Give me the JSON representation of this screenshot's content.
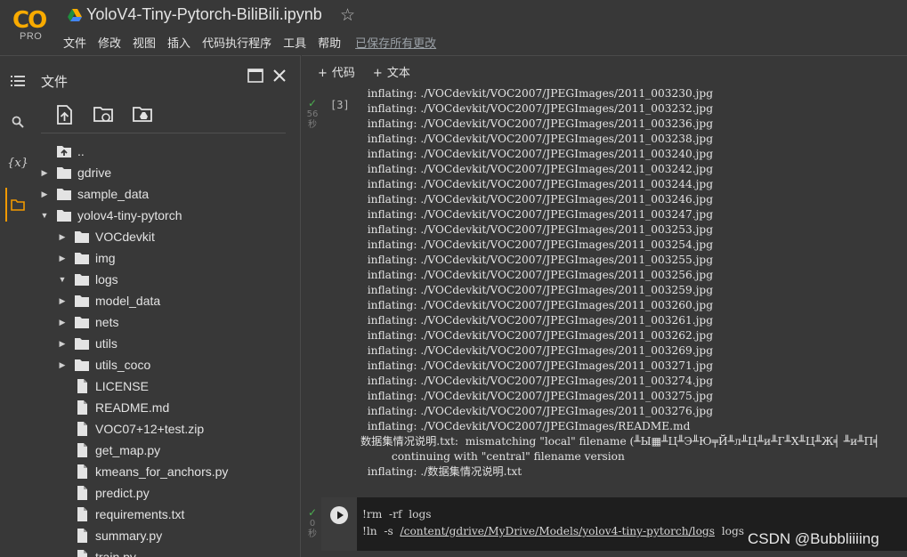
{
  "logo": {
    "text": "CO",
    "sub": "PRO"
  },
  "notebook": {
    "title": "YoloV4-Tiny-Pytorch-BiliBili.ipynb"
  },
  "menu": [
    "文件",
    "修改",
    "视图",
    "插入",
    "代码执行程序",
    "工具",
    "帮助"
  ],
  "saved_status": "已保存所有更改",
  "files_panel": {
    "title": "文件"
  },
  "tree": [
    {
      "name": "..",
      "type": "up",
      "caret": "",
      "depth": 0
    },
    {
      "name": "gdrive",
      "type": "folder",
      "caret": "▶",
      "depth": 0
    },
    {
      "name": "sample_data",
      "type": "folder",
      "caret": "▶",
      "depth": 0
    },
    {
      "name": "yolov4-tiny-pytorch",
      "type": "folder",
      "caret": "▼",
      "depth": 0
    },
    {
      "name": "VOCdevkit",
      "type": "folder",
      "caret": "▶",
      "depth": 1
    },
    {
      "name": "img",
      "type": "folder",
      "caret": "▶",
      "depth": 1
    },
    {
      "name": "logs",
      "type": "folder",
      "caret": "▼",
      "depth": 1
    },
    {
      "name": "model_data",
      "type": "folder",
      "caret": "▶",
      "depth": 1
    },
    {
      "name": "nets",
      "type": "folder",
      "caret": "▶",
      "depth": 1
    },
    {
      "name": "utils",
      "type": "folder",
      "caret": "▶",
      "depth": 1
    },
    {
      "name": "utils_coco",
      "type": "folder",
      "caret": "▶",
      "depth": 1
    },
    {
      "name": "LICENSE",
      "type": "file",
      "caret": "",
      "depth": 1
    },
    {
      "name": "README.md",
      "type": "file",
      "caret": "",
      "depth": 1
    },
    {
      "name": "VOC07+12+test.zip",
      "type": "file",
      "caret": "",
      "depth": 1
    },
    {
      "name": "get_map.py",
      "type": "file",
      "caret": "",
      "depth": 1
    },
    {
      "name": "kmeans_for_anchors.py",
      "type": "file",
      "caret": "",
      "depth": 1
    },
    {
      "name": "predict.py",
      "type": "file",
      "caret": "",
      "depth": 1
    },
    {
      "name": "requirements.txt",
      "type": "file",
      "caret": "",
      "depth": 1
    },
    {
      "name": "summary.py",
      "type": "file",
      "caret": "",
      "depth": 1
    },
    {
      "name": "train.py",
      "type": "file",
      "caret": "",
      "depth": 1
    }
  ],
  "cell_toolbar": {
    "code": "代码",
    "text": "文本"
  },
  "cell1": {
    "count": "[3]",
    "time_value": "56",
    "time_unit": "秒"
  },
  "output_lines": [
    "  inflating: ./VOCdevkit/VOC2007/JPEGImages/2011_003230.jpg",
    "  inflating: ./VOCdevkit/VOC2007/JPEGImages/2011_003232.jpg",
    "  inflating: ./VOCdevkit/VOC2007/JPEGImages/2011_003236.jpg",
    "  inflating: ./VOCdevkit/VOC2007/JPEGImages/2011_003238.jpg",
    "  inflating: ./VOCdevkit/VOC2007/JPEGImages/2011_003240.jpg",
    "  inflating: ./VOCdevkit/VOC2007/JPEGImages/2011_003242.jpg",
    "  inflating: ./VOCdevkit/VOC2007/JPEGImages/2011_003244.jpg",
    "  inflating: ./VOCdevkit/VOC2007/JPEGImages/2011_003246.jpg",
    "  inflating: ./VOCdevkit/VOC2007/JPEGImages/2011_003247.jpg",
    "  inflating: ./VOCdevkit/VOC2007/JPEGImages/2011_003253.jpg",
    "  inflating: ./VOCdevkit/VOC2007/JPEGImages/2011_003254.jpg",
    "  inflating: ./VOCdevkit/VOC2007/JPEGImages/2011_003255.jpg",
    "  inflating: ./VOCdevkit/VOC2007/JPEGImages/2011_003256.jpg",
    "  inflating: ./VOCdevkit/VOC2007/JPEGImages/2011_003259.jpg",
    "  inflating: ./VOCdevkit/VOC2007/JPEGImages/2011_003260.jpg",
    "  inflating: ./VOCdevkit/VOC2007/JPEGImages/2011_003261.jpg",
    "  inflating: ./VOCdevkit/VOC2007/JPEGImages/2011_003262.jpg",
    "  inflating: ./VOCdevkit/VOC2007/JPEGImages/2011_003269.jpg",
    "  inflating: ./VOCdevkit/VOC2007/JPEGImages/2011_003271.jpg",
    "  inflating: ./VOCdevkit/VOC2007/JPEGImages/2011_003274.jpg",
    "  inflating: ./VOCdevkit/VOC2007/JPEGImages/2011_003275.jpg",
    "  inflating: ./VOCdevkit/VOC2007/JPEGImages/2011_003276.jpg",
    "  inflating: ./VOCdevkit/VOC2007/JPEGImages/README.md",
    "数据集情况说明.txt:  mismatching \"local\" filename (╨Ы▦╨Ц╨Э╨Ю╤Й╨л╨Ц╨и╨Г╨Х╨Ц╨Ж╡ ╨и╨П╡",
    "         continuing with \"central\" filename version",
    "  inflating: ./数据集情况说明.txt"
  ],
  "cell2": {
    "time_value": "0",
    "time_unit": "秒",
    "line1": "!rm  -rf  logs",
    "line2_prefix": "!ln  -s  ",
    "line2_path": "/content/gdrive/MyDrive/Models/yolov4-tiny-pytorch/logs",
    "line2_suffix": "  logs"
  },
  "watermark": "CSDN @Bubbliiiing",
  "colors": {
    "accent": "#f29900",
    "success": "#4caf50",
    "logo": "#f9ab00"
  }
}
